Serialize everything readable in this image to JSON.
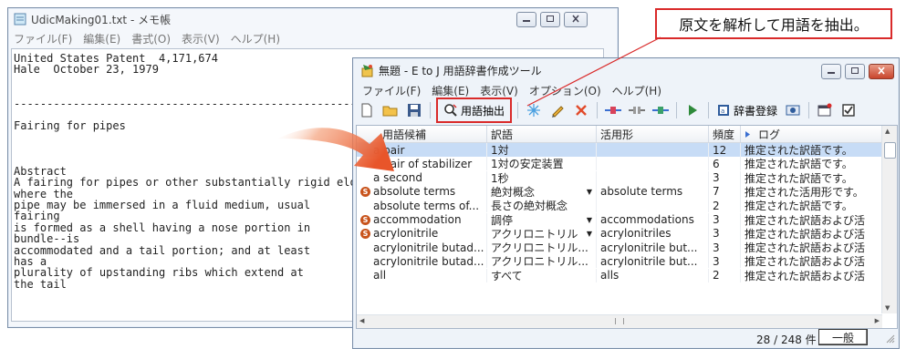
{
  "notepad": {
    "title": "UdicMaking01.txt - メモ帳",
    "menu": [
      "ファイル(F)",
      "編集(E)",
      "書式(O)",
      "表示(V)",
      "ヘルプ(H)"
    ],
    "lines": [
      "United States Patent  4,171,674",
      "Hale  October 23, 1979",
      "",
      "",
      "-----------------------------------------------------------------",
      "",
      "Fairing for pipes",
      "",
      "",
      "",
      "Abstract",
      "A fairing for pipes or other substantially rigid elongate bodies",
      "where the",
      "pipe may be immersed in a fluid medium, usual",
      "fairing",
      "is formed as a shell having a nose portion in",
      "bundle--is",
      "accommodated and a tail portion; and at least",
      "has a",
      "plurality of upstanding ribs which extend at",
      "the tail"
    ]
  },
  "callout": {
    "text": "原文を解析して用語を抽出。"
  },
  "app": {
    "title": "無題 - E to J 用語辞書作成ツール",
    "menu": [
      "ファイル(F)",
      "編集(E)",
      "表示(V)",
      "オプション(O)",
      "ヘルプ(H)"
    ],
    "toolbar": {
      "extract_label": "用語抽出",
      "dict_register_label": "辞書登録"
    },
    "columns": [
      "用語候補",
      "訳語",
      "活用形",
      "頻度",
      "ログ"
    ],
    "rows": [
      {
        "term": "a pair",
        "translation": "1対",
        "conjugation": "",
        "freq": "12",
        "log": "推定された訳語です。",
        "badge": false,
        "dropdown": false
      },
      {
        "term": "a pair of stabilizer",
        "translation": "1対の安定装置",
        "conjugation": "",
        "freq": "6",
        "log": "推定された訳語です。",
        "badge": false,
        "dropdown": false
      },
      {
        "term": "a second",
        "translation": "1秒",
        "conjugation": "",
        "freq": "3",
        "log": "推定された訳語です。",
        "badge": false,
        "dropdown": false
      },
      {
        "term": "absolute terms",
        "translation": "絶対概念",
        "conjugation": "absolute terms",
        "freq": "7",
        "log": "推定された活用形です。",
        "badge": true,
        "dropdown": true
      },
      {
        "term": "absolute terms of...",
        "translation": "長さの絶対概念",
        "conjugation": "",
        "freq": "2",
        "log": "推定された訳語です。",
        "badge": false,
        "dropdown": false
      },
      {
        "term": "accommodation",
        "translation": "調停",
        "conjugation": "accommodations",
        "freq": "3",
        "log": "推定された訳語および活",
        "badge": true,
        "dropdown": true
      },
      {
        "term": "acrylonitrile",
        "translation": "アクリロニトリル",
        "conjugation": "acrylonitriles",
        "freq": "3",
        "log": "推定された訳語および活",
        "badge": true,
        "dropdown": true
      },
      {
        "term": "acrylonitrile butad...",
        "translation": "アクリロニトリル...",
        "conjugation": "acrylonitrile but...",
        "freq": "3",
        "log": "推定された訳語および活",
        "badge": false,
        "dropdown": false
      },
      {
        "term": "acrylonitrile butad...",
        "translation": "アクリロニトリル...",
        "conjugation": "acrylonitrile but...",
        "freq": "3",
        "log": "推定された訳語および活",
        "badge": false,
        "dropdown": false
      },
      {
        "term": "all",
        "translation": "すべて",
        "conjugation": "alls",
        "freq": "2",
        "log": "推定された訳語および活",
        "badge": false,
        "dropdown": false
      }
    ],
    "status": {
      "count": "28 / 248 件",
      "mode": "一般"
    }
  },
  "colors": {
    "accent_red": "#d92a2a",
    "arrow_orange": "#e8552a",
    "badge_orange": "#c8531b",
    "selection_blue": "#c7dcf6"
  }
}
